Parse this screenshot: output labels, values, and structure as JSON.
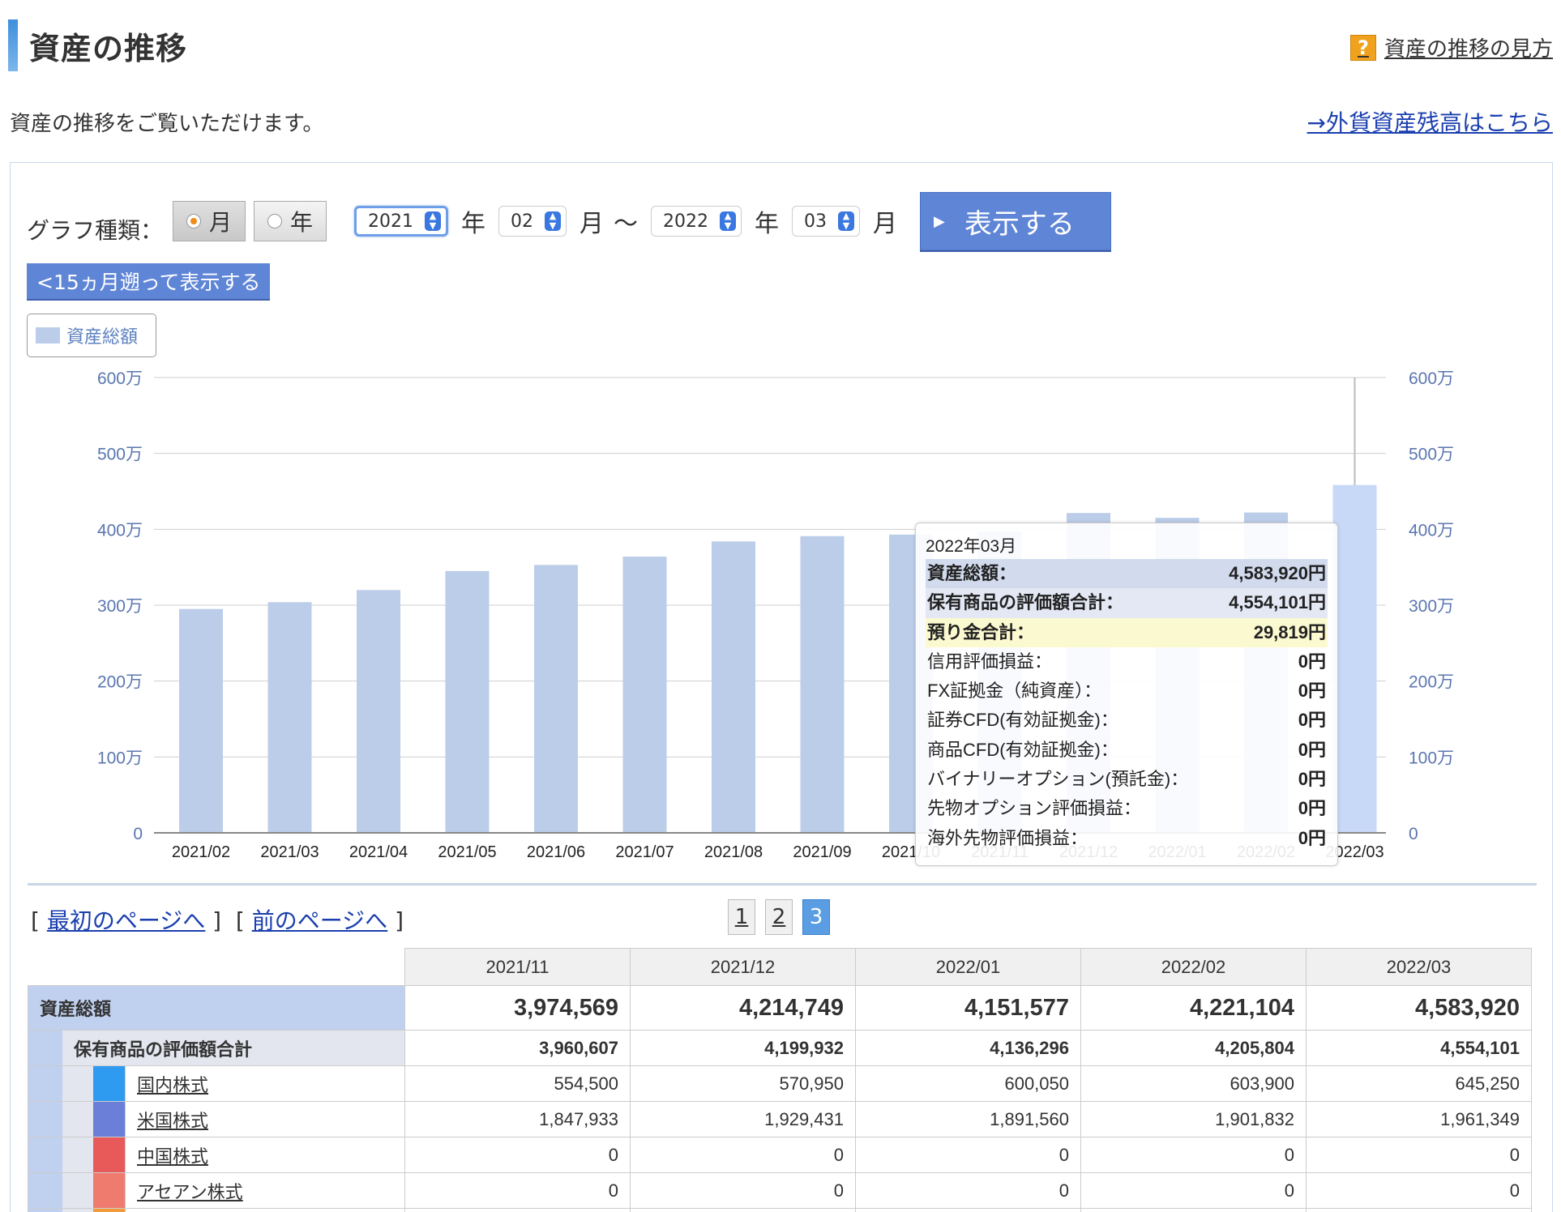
{
  "header": {
    "title": "資産の推移",
    "help_icon": "?",
    "help_link": "資産の推移の見方",
    "description": "資産の推移をご覧いただけます。",
    "fx_link": "→外貨資産残高はこちら"
  },
  "controls": {
    "graph_type_label": "グラフ種類：",
    "radio_month": "月",
    "radio_year": "年",
    "selected_radio": "月",
    "start_year": "2021",
    "start_month": "02",
    "end_year": "2022",
    "end_month": "03",
    "year_unit": "年",
    "month_unit": "月",
    "range_sep": "〜",
    "show_button": "表示する",
    "back_button": "<15ヵ月遡って表示する"
  },
  "legend": {
    "label": "資産総額",
    "color": "#bccde9"
  },
  "chart_data": {
    "type": "bar",
    "categories": [
      "2021/02",
      "2021/03",
      "2021/04",
      "2021/05",
      "2021/06",
      "2021/07",
      "2021/08",
      "2021/09",
      "2021/10",
      "2021/11",
      "2021/12",
      "2022/01",
      "2022/02",
      "2022/03"
    ],
    "series": [
      {
        "name": "資産総額",
        "values": [
          2950000,
          3040000,
          3200000,
          3450000,
          3530000,
          3640000,
          3840000,
          3910000,
          3930000,
          3974569,
          4214749,
          4151577,
          4221104,
          4583920
        ],
        "color": "#bccde9",
        "highlight_color": "#c8d8f7"
      }
    ],
    "y_ticks": [
      "0",
      "100万",
      "200万",
      "300万",
      "400万",
      "500万",
      "600万"
    ],
    "ylim": [
      0,
      6000000
    ],
    "grid": true,
    "highlighted_category": "2022/03"
  },
  "tooltip": {
    "date": "2022年03月",
    "rows": [
      {
        "label": "資産総額：",
        "value": "4,583,920円",
        "style": "total"
      },
      {
        "label": "保有商品の評価額合計：",
        "value": "4,554,101円",
        "style": "holding"
      },
      {
        "label": "預り金合計：",
        "value": "29,819円",
        "style": "cash"
      },
      {
        "label": "信用評価損益：",
        "value": "0円",
        "style": "plain"
      },
      {
        "label": "FX証拠金（純資産）：",
        "value": "0円",
        "style": "plain"
      },
      {
        "label": "証券CFD(有効証拠金)：",
        "value": "0円",
        "style": "plain"
      },
      {
        "label": "商品CFD(有効証拠金)：",
        "value": "0円",
        "style": "plain"
      },
      {
        "label": "バイナリーオプション(預託金)：",
        "value": "0円",
        "style": "plain"
      },
      {
        "label": "先物オプション評価損益：",
        "value": "0円",
        "style": "plain"
      },
      {
        "label": "海外先物評価損益：",
        "value": "0円",
        "style": "plain"
      }
    ]
  },
  "pagination": {
    "first_page": "最初のページへ",
    "prev_page": "前のページへ",
    "pages": [
      "1",
      "2",
      "3"
    ],
    "current": "3"
  },
  "table": {
    "columns": [
      "2021/11",
      "2021/12",
      "2022/01",
      "2022/02",
      "2022/03"
    ],
    "total": {
      "label": "資産総額",
      "values": [
        "3,974,569",
        "4,214,749",
        "4,151,577",
        "4,221,104",
        "4,583,920"
      ]
    },
    "holdings": {
      "label": "保有商品の評価額合計",
      "values": [
        "3,960,607",
        "4,199,932",
        "4,136,296",
        "4,205,804",
        "4,554,101"
      ]
    },
    "items": [
      {
        "label": "国内株式",
        "color": "#2f9bf0",
        "values": [
          "554,500",
          "570,950",
          "600,050",
          "603,900",
          "645,250"
        ]
      },
      {
        "label": "米国株式",
        "color": "#6b7fd9",
        "values": [
          "1,847,933",
          "1,929,431",
          "1,891,560",
          "1,901,832",
          "1,961,349"
        ]
      },
      {
        "label": "中国株式",
        "color": "#e85a5a",
        "values": [
          "0",
          "0",
          "0",
          "0",
          "0"
        ]
      },
      {
        "label": "アセアン株式",
        "color": "#ef7a6e",
        "values": [
          "0",
          "0",
          "0",
          "0",
          "0"
        ]
      }
    ],
    "partial_row_color": "#f39a3b"
  }
}
